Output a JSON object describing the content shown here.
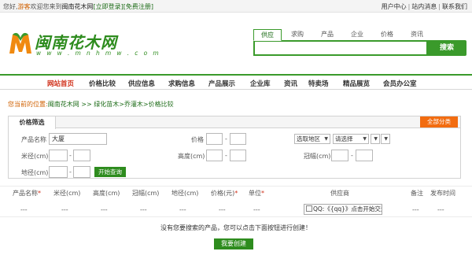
{
  "topbar": {
    "hello": "您好,",
    "guest": "游客",
    "welcome": "欢迎您来到",
    "site_name": "闽南花木网",
    "login": "[立即登录]",
    "register": "[免费注册]",
    "links": [
      "用户中心",
      "站内消息",
      "联系我们"
    ]
  },
  "logo": {
    "name": "闽南花木网",
    "url": "w w w . m n h m w . c o m"
  },
  "search": {
    "tabs": [
      "供应",
      "求购",
      "产品",
      "企业",
      "价格",
      "资讯"
    ],
    "active_tab": 0,
    "value": "",
    "button": "搜索"
  },
  "nav": {
    "items": [
      "网站首页",
      "价格比较",
      "供应信息",
      "求购信息",
      "产品展示",
      "企业库",
      "资讯",
      "特卖场",
      "精品展览",
      "会员办公室"
    ],
    "active": 0
  },
  "breadcrumb": {
    "label": "您当前的位置:",
    "path": "闽南花木网 >> 绿化苗木>乔灌木>价格比较"
  },
  "filter": {
    "tab": "价格筛选",
    "all_categories": "全部分类",
    "product_name_label": "产品名称",
    "product_name_value": "大厦",
    "price_label": "价格",
    "region_select": "选取地区",
    "choose_select": "请选择",
    "diameter_label": "米径(cm)",
    "height_label": "高度(cm)",
    "crown_label": "冠幅(cm)",
    "ground_label": "地径(cm)",
    "dash": "-",
    "query_button": "开始查询"
  },
  "table": {
    "headers": [
      "产品名称",
      "米径(cm)",
      "高度(cm)",
      "冠幅(cm)",
      "地径(cm)",
      "价格(元)",
      "单位",
      "供应商",
      "备注",
      "发布时间"
    ],
    "required_marker": "*",
    "empty_cell": "---",
    "qq_text": "QQ:《{qq}》点击开始交流"
  },
  "notice": "没有您要搜索的产品，您可以点击下面按钮进行创建！",
  "create_button": "我要创建",
  "colors": {
    "brand_green": "#2e8c1e",
    "accent_orange": "#f26c10",
    "nav_active_red": "#d0301a"
  }
}
